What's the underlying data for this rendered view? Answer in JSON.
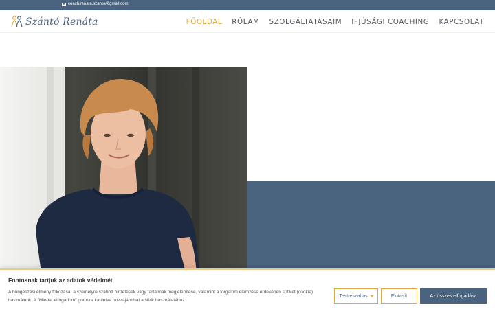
{
  "topbar": {
    "email": "coach.renata.szanto@gmail.com",
    "email_icon": "envelope-icon"
  },
  "header": {
    "logo_text": "Szántó Renáta",
    "nav": [
      {
        "label": "FŐOLDAL",
        "active": true
      },
      {
        "label": "RÓLAM",
        "active": false
      },
      {
        "label": "SZOLGÁLTATÁSAIM",
        "active": false
      },
      {
        "label": "IFJÚSÁGI COACHING",
        "active": false
      },
      {
        "label": "KAPCSOLAT",
        "active": false
      }
    ]
  },
  "colors": {
    "brand_blue": "#4a6480",
    "accent_gold": "#e0a840"
  },
  "cookie": {
    "title": "Fontosnak tartjuk az adatok védelmét",
    "text": "A böngészési élmény fokozása, a személyre szabott hirdetések vagy tartalmak megjelenítése, valamint a forgalom elemzése érdekében sütiket (cookie) használunk. A \"Mindet elfogadom\" gombra kattintva hozzájárulhat a sütik használatához.",
    "customize_label": "Testreszabás",
    "reject_label": "Elutasít",
    "accept_label": "Az összes elfogadása"
  }
}
